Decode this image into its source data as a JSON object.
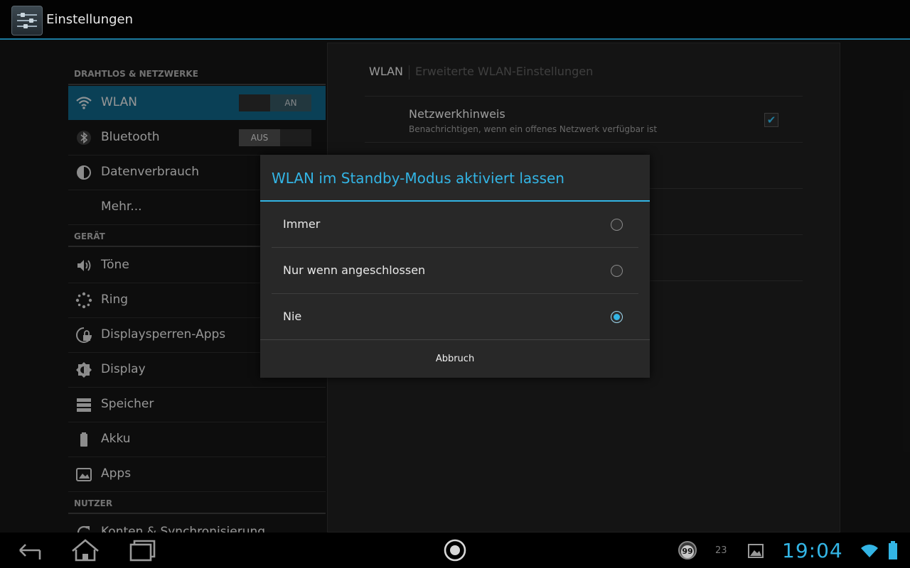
{
  "actionbar": {
    "title": "Einstellungen",
    "icon": "settings-sliders-icon"
  },
  "settings": {
    "sections": [
      {
        "header": "DRAHTLOS & NETZWERKE"
      },
      {
        "header": "GERÄT"
      },
      {
        "header": "NUTZER"
      }
    ],
    "items": [
      {
        "label": "WLAN",
        "icon": "wifi-icon",
        "toggle": "AN",
        "selected": true
      },
      {
        "label": "Bluetooth",
        "icon": "bluetooth-icon",
        "toggle": "AUS"
      },
      {
        "label": "Datenverbrauch",
        "icon": "data-usage-icon"
      },
      {
        "label": "Mehr...",
        "icon": ""
      },
      {
        "label": "Töne",
        "icon": "speaker-icon"
      },
      {
        "label": "Ring",
        "icon": "ring-icon"
      },
      {
        "label": "Displaysperren-Apps",
        "icon": "lock-app-icon"
      },
      {
        "label": "Display",
        "icon": "brightness-icon"
      },
      {
        "label": "Speicher",
        "icon": "storage-icon"
      },
      {
        "label": "Akku",
        "icon": "battery-icon"
      },
      {
        "label": "Apps",
        "icon": "apps-icon"
      },
      {
        "label": "Konten & Synchronisierung",
        "icon": "sync-icon"
      }
    ]
  },
  "panel": {
    "breadcrumb": [
      "WLAN",
      "Erweiterte WLAN-Einstellungen"
    ],
    "pref_title": "Netzwerkhinweis",
    "pref_summary": "Benachrichtigen, wenn ein offenes Netzwerk verfügbar ist",
    "pref_checked": true
  },
  "dialog": {
    "title": "WLAN im Standby-Modus aktiviert lassen",
    "options": [
      "Immer",
      "Nur wenn angeschlossen",
      "Nie"
    ],
    "selected_option": "Nie",
    "cancel": "Abbruch",
    "accent": "#33b5e5"
  },
  "statusbar": {
    "time": "19:04",
    "notification_count": "99",
    "temperature": "23"
  }
}
